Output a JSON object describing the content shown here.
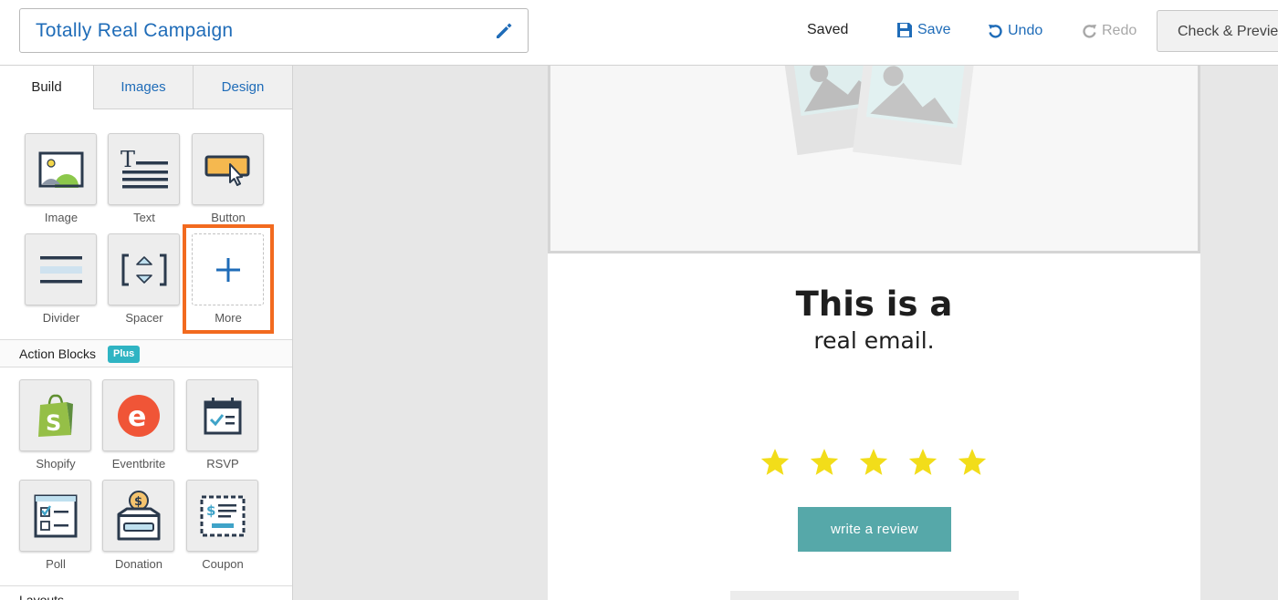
{
  "header": {
    "campaign_name": "Totally Real Campaign",
    "saved_status": "Saved",
    "save_label": "Save",
    "undo_label": "Undo",
    "redo_label": "Redo",
    "check_preview_label": "Check & Preview"
  },
  "sidebar": {
    "tabs": [
      {
        "label": "Build",
        "active": true
      },
      {
        "label": "Images",
        "active": false
      },
      {
        "label": "Design",
        "active": false
      }
    ],
    "blocks": [
      {
        "label": "Image",
        "icon": "image-icon"
      },
      {
        "label": "Text",
        "icon": "text-icon"
      },
      {
        "label": "Button",
        "icon": "button-cursor-icon"
      },
      {
        "label": "Divider",
        "icon": "divider-icon"
      },
      {
        "label": "Spacer",
        "icon": "spacer-icon"
      },
      {
        "label": "More",
        "icon": "plus-icon"
      }
    ],
    "action_blocks": {
      "title": "Action Blocks",
      "badge": "Plus",
      "items": [
        {
          "label": "Shopify",
          "icon": "shopify-icon"
        },
        {
          "label": "Eventbrite",
          "icon": "eventbrite-icon"
        },
        {
          "label": "RSVP",
          "icon": "calendar-check-icon"
        },
        {
          "label": "Poll",
          "icon": "poll-icon"
        },
        {
          "label": "Donation",
          "icon": "donation-icon"
        },
        {
          "label": "Coupon",
          "icon": "coupon-icon"
        }
      ]
    },
    "layouts_title": "Layouts"
  },
  "email": {
    "headline": "This is a",
    "subline": "real email.",
    "rating": 5,
    "rating_max": 5,
    "review_button": "write a review"
  },
  "colors": {
    "link_blue": "#1f6cb8",
    "highlight_orange": "#f26a1f",
    "star_yellow": "#f2dd1a",
    "review_button": "#56a8a9",
    "plus_badge": "#2fb4c3"
  }
}
